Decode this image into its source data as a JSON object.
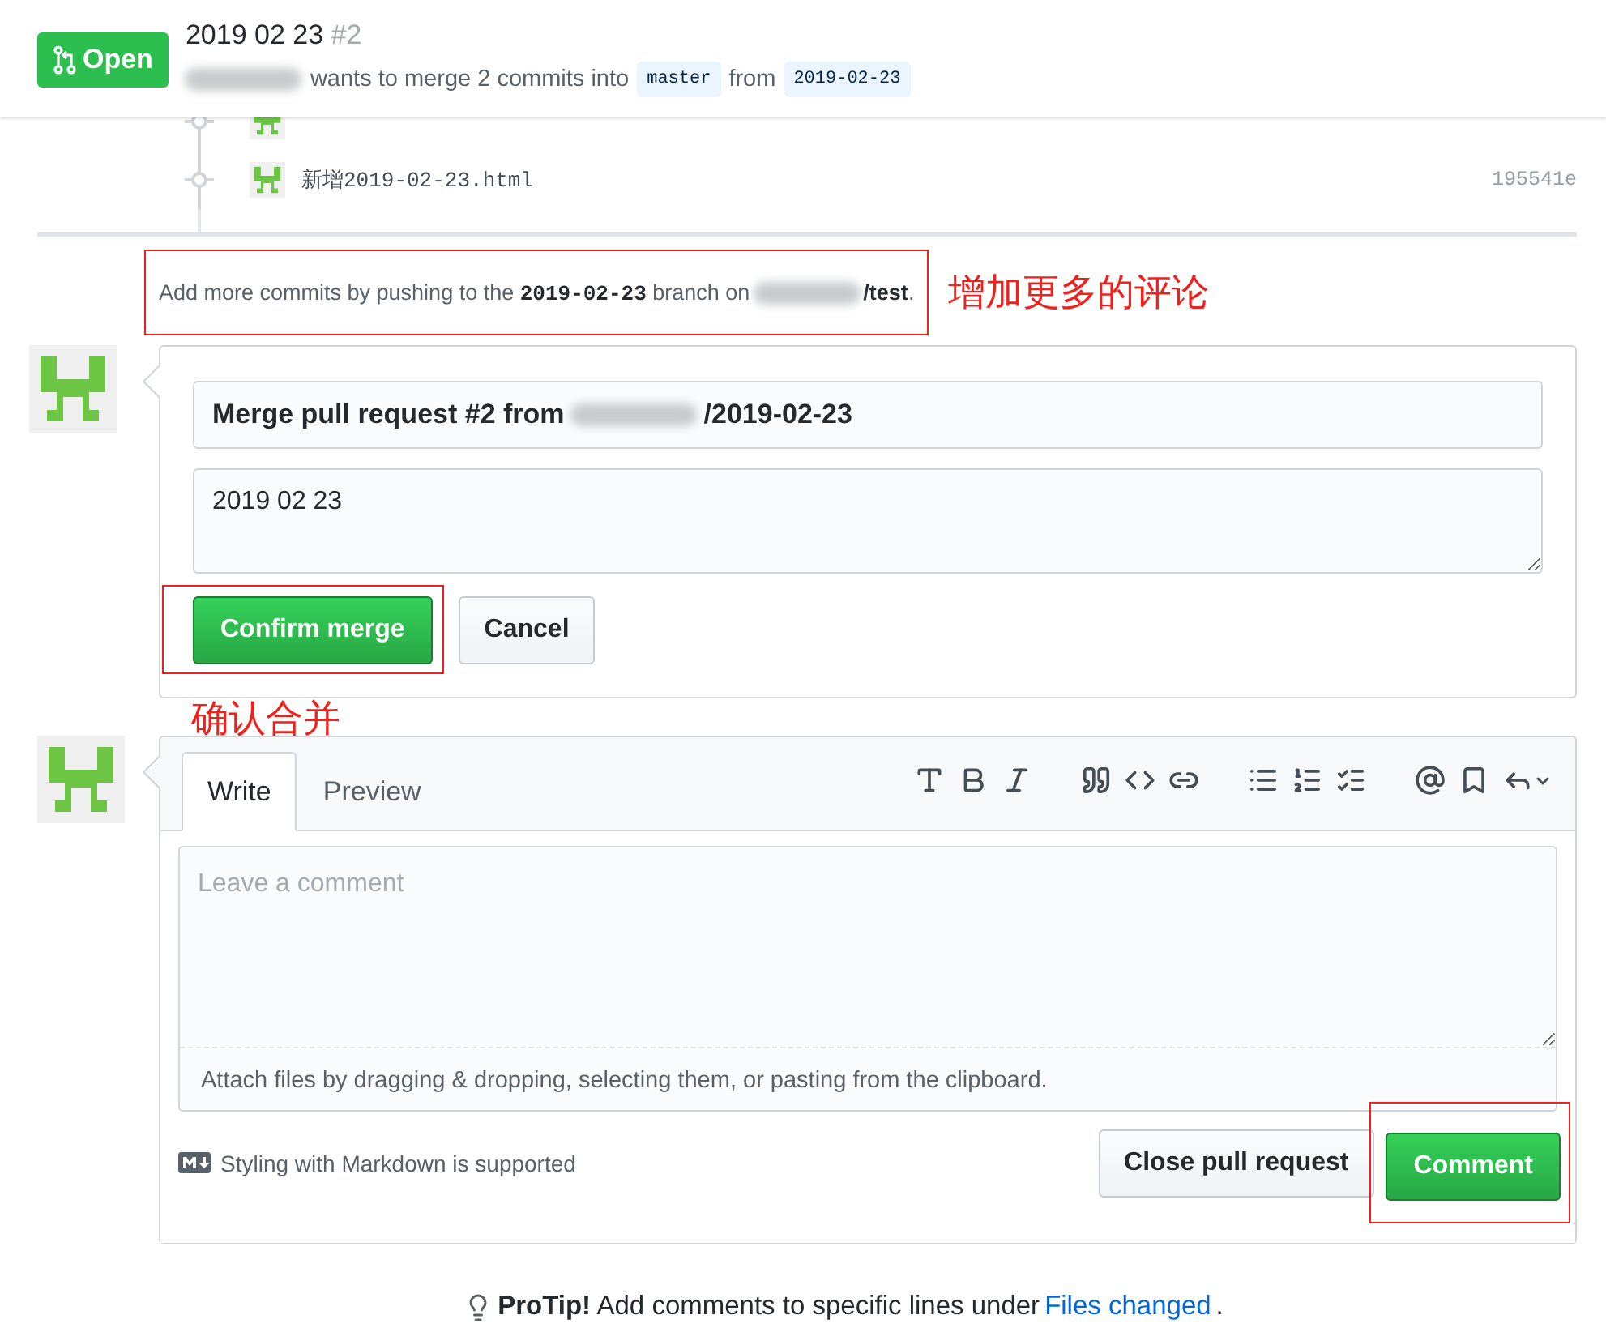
{
  "header": {
    "state": {
      "label": "Open"
    },
    "title": "2019 02 23",
    "number": "#2",
    "summary": "wants to merge 2 commits into",
    "base_branch": "master",
    "from_word": "from",
    "head_branch": "2019-02-23"
  },
  "commits": [
    {
      "message": "新增2019-02-23.html",
      "sha": "195541e"
    }
  ],
  "push_hint": "Add more commits by pushing to the **2019-02-23** branch on",
  "push_repo": "/test",
  "push_end": ".",
  "annotations": [
    "增加更多的评论",
    "确认合并"
  ],
  "merge_form": {
    "title_before": "Merge pull request #2 from",
    "title_after": "/2019-02-23",
    "message": "2019 02 23",
    "confirm": "Confirm merge",
    "cancel": "Cancel"
  },
  "comment_form": {
    "tabs": [
      {
        "label": "Write",
        "selected": true
      },
      {
        "label": "Preview",
        "selected": false
      }
    ],
    "placeholder": "Leave a comment",
    "attach": "Attach files by dragging & dropping, selecting them, or pasting from the clipboard.",
    "markdown": "Styling with Markdown is supported",
    "close": "Close pull request",
    "comment": "Comment"
  },
  "protip": {
    "title": "ProTip!",
    "text": "Add comments to specific lines under",
    "link": "Files changed",
    "end": "."
  }
}
